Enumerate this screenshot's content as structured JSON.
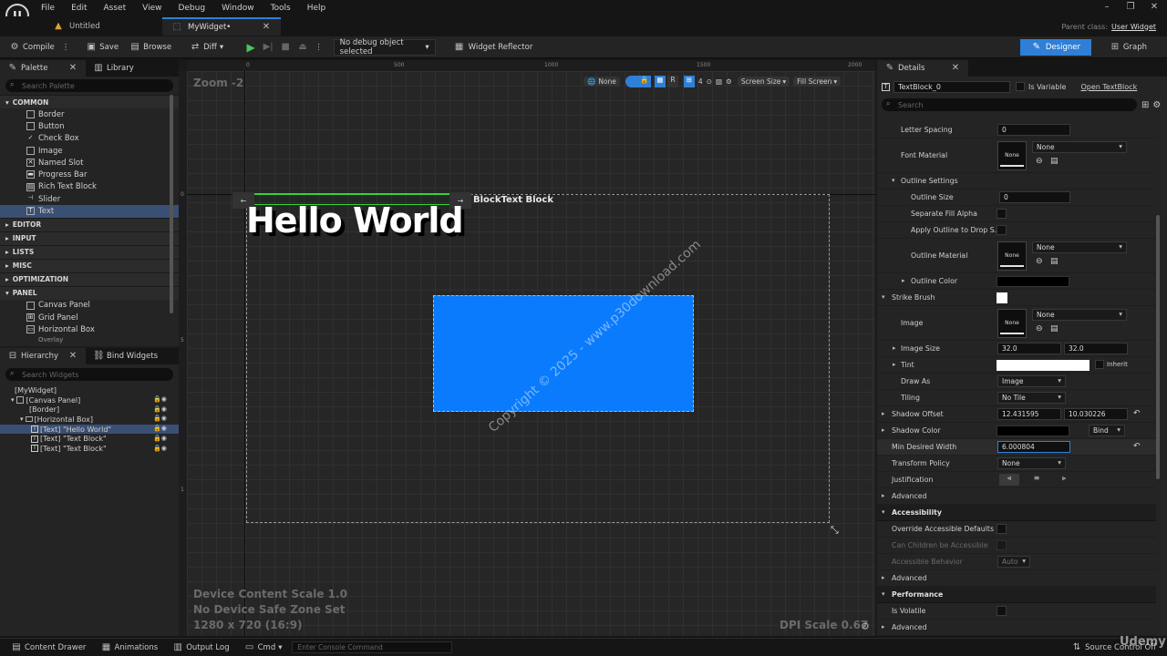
{
  "menu": [
    "File",
    "Edit",
    "Asset",
    "View",
    "Debug",
    "Window",
    "Tools",
    "Help"
  ],
  "window": {
    "parent_class_label": "Parent class:",
    "parent_class_value": "User Widget"
  },
  "tabs": [
    {
      "label": "Untitled"
    },
    {
      "label": "MyWidget•"
    }
  ],
  "toolbar": {
    "compile": "Compile",
    "save": "Save",
    "browse": "Browse",
    "diff": "Diff",
    "debug_object": "No debug object selected",
    "widget_reflector": "Widget Reflector",
    "designer": "Designer",
    "graph": "Graph"
  },
  "palette": {
    "tab": "Palette",
    "library_tab": "Library",
    "search_placeholder": "Search Palette",
    "categories": {
      "common": "COMMON",
      "editor": "EDITOR",
      "input": "INPUT",
      "lists": "LISTS",
      "misc": "MISC",
      "optimization": "OPTIMIZATION",
      "panel": "PANEL"
    },
    "common_items": [
      "Border",
      "Button",
      "Check Box",
      "Image",
      "Named Slot",
      "Progress Bar",
      "Rich Text Block",
      "Slider",
      "Text"
    ],
    "panel_items": [
      "Canvas Panel",
      "Grid Panel",
      "Horizontal Box",
      "Overlay"
    ]
  },
  "hierarchy": {
    "tab": "Hierarchy",
    "bind_tab": "Bind Widgets",
    "search_placeholder": "Search Widgets",
    "items": [
      "[MyWidget]",
      "[Canvas Panel]",
      "[Border]",
      "[Horizontal Box]",
      "[Text] \"Hello World\"",
      "[Text] \"Text Block\"",
      "[Text] \"Text Block\""
    ]
  },
  "viewport": {
    "zoom": "Zoom -2",
    "ruler_labels": [
      "0",
      "500",
      "1000",
      "1500",
      "2000"
    ],
    "vruler_labels": [
      "0",
      "5",
      "1"
    ],
    "hello_text": "Hello World",
    "block_text": "BlockText Block",
    "none_label": "None",
    "r_label": "R",
    "four_label": "4",
    "screen_size": "Screen Size",
    "fill_screen": "Fill Screen",
    "device_scale": "Device Content Scale 1.0",
    "safe_zone": "No Device Safe Zone Set",
    "resolution": "1280 x 720 (16:9)",
    "dpi": "DPI Scale 0.67",
    "watermark": "Copyright © 2025 - www.p30download.com",
    "colors": {
      "blue_box": "#0a7bfc",
      "accent": "#2f7fd6"
    }
  },
  "details": {
    "tab": "Details",
    "name_value": "TextBlock_0",
    "is_variable": "Is Variable",
    "open_text_block": "Open TextBlock",
    "search_placeholder": "Search",
    "letter_spacing": {
      "label": "Letter Spacing",
      "value": "0"
    },
    "font_material": {
      "label": "Font Material",
      "thumb": "None",
      "value": "None"
    },
    "outline_settings": "Outline Settings",
    "outline_size": {
      "label": "Outline Size",
      "value": "0"
    },
    "separate_fill_alpha": "Separate Fill Alpha",
    "apply_outline": "Apply Outline to Drop S...",
    "outline_material": {
      "label": "Outline Material",
      "thumb": "None",
      "value": "None"
    },
    "outline_color": "Outline Color",
    "strike_brush": "Strike Brush",
    "image": {
      "label": "Image",
      "thumb": "None",
      "value": "None"
    },
    "image_size": {
      "label": "Image Size",
      "x": "32.0",
      "y": "32.0"
    },
    "tint": {
      "label": "Tint",
      "inherit": "Inherit"
    },
    "draw_as": {
      "label": "Draw As",
      "value": "Image"
    },
    "tiling": {
      "label": "Tiling",
      "value": "No Tile"
    },
    "shadow_offset": {
      "label": "Shadow Offset",
      "x": "12.431595",
      "y": "10.030226"
    },
    "shadow_color": {
      "label": "Shadow Color",
      "bind": "Bind"
    },
    "min_desired_width": {
      "label": "Min Desired Width",
      "value": "6.000804"
    },
    "transform_policy": {
      "label": "Transform Policy",
      "value": "None"
    },
    "justification": "Justification",
    "advanced": "Advanced",
    "accessibility": "Accessibility",
    "override_accessible": "Override Accessible Defaults",
    "can_children": "Can Children be Accessible",
    "accessible_behavior": {
      "label": "Accessible Behavior",
      "value": "Auto"
    },
    "advanced2": "Advanced",
    "performance": "Performance",
    "is_volatile": "Is Volatile",
    "advanced3": "Advanced"
  },
  "statusbar": {
    "content_drawer": "Content Drawer",
    "animations": "Animations",
    "output_log": "Output Log",
    "cmd": "Cmd",
    "console_placeholder": "Enter Console Command",
    "source_control": "Source Control Off",
    "udemy": "Udemy"
  }
}
